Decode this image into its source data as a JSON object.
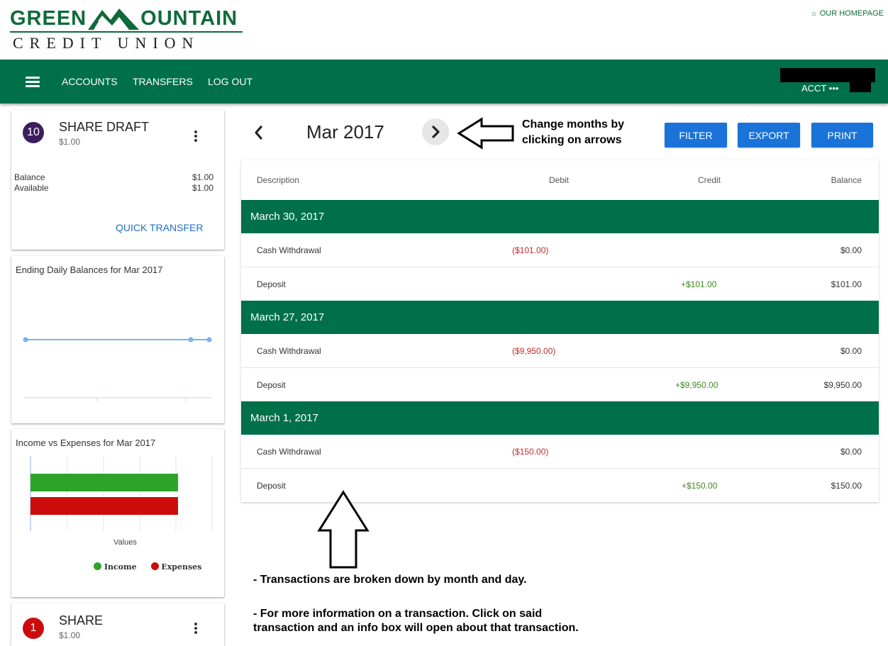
{
  "brand": {
    "top_left": "GREEN",
    "top_right": "OUNTAIN",
    "bottom": "CREDIT UNION"
  },
  "header": {
    "homepage_link": "OUR HOMEPAGE"
  },
  "nav": {
    "items": [
      "ACCOUNTS",
      "TRANSFERS",
      "LOG OUT"
    ],
    "acct_label": "ACCT •••"
  },
  "account_card": {
    "badge": "10",
    "name": "SHARE DRAFT",
    "amount": "$1.00",
    "balance_label": "Balance",
    "balance_value": "$1.00",
    "available_label": "Available",
    "available_value": "$1.00",
    "quick_transfer": "QUICK TRANSFER"
  },
  "balances_chart": {
    "title": "Ending Daily Balances for Mar 2017"
  },
  "income_chart": {
    "title": "Income vs Expenses for Mar 2017",
    "axis_label": "Values",
    "legend": [
      "Income",
      "Expenses"
    ],
    "colors": {
      "income": "#2ea32a",
      "expenses": "#cc0c0c"
    }
  },
  "second_account": {
    "badge": "1",
    "name": "SHARE",
    "amount": "$1.00"
  },
  "month_nav": {
    "label": "Mar 2017"
  },
  "annotations": {
    "arrows_line1": "Change months by",
    "arrows_line2": "clicking on arrows",
    "note1": "- Transactions are broken down by month and day.",
    "note2_line1": "- For more information on a transaction. Click on said",
    "note2_line2": "transaction and an info box will open about that transaction."
  },
  "buttons": {
    "filter": "FILTER",
    "export": "EXPORT",
    "print": "PRINT"
  },
  "table": {
    "headers": {
      "description": "Description",
      "debit": "Debit",
      "credit": "Credit",
      "balance": "Balance"
    },
    "groups": [
      {
        "date": "March 30, 2017",
        "rows": [
          {
            "description": "Cash Withdrawal",
            "debit": "($101.00)",
            "credit": "",
            "balance": "$0.00"
          },
          {
            "description": "Deposit",
            "debit": "",
            "credit": "+$101.00",
            "balance": "$101.00"
          }
        ]
      },
      {
        "date": "March 27, 2017",
        "rows": [
          {
            "description": "Cash Withdrawal",
            "debit": "($9,950.00)",
            "credit": "",
            "balance": "$0.00"
          },
          {
            "description": "Deposit",
            "debit": "",
            "credit": "+$9,950.00",
            "balance": "$9,950.00"
          }
        ]
      },
      {
        "date": "March 1, 2017",
        "rows": [
          {
            "description": "Cash Withdrawal",
            "debit": "($150.00)",
            "credit": "",
            "balance": "$0.00"
          },
          {
            "description": "Deposit",
            "debit": "",
            "credit": "+$150.00",
            "balance": "$150.00"
          }
        ]
      }
    ]
  }
}
